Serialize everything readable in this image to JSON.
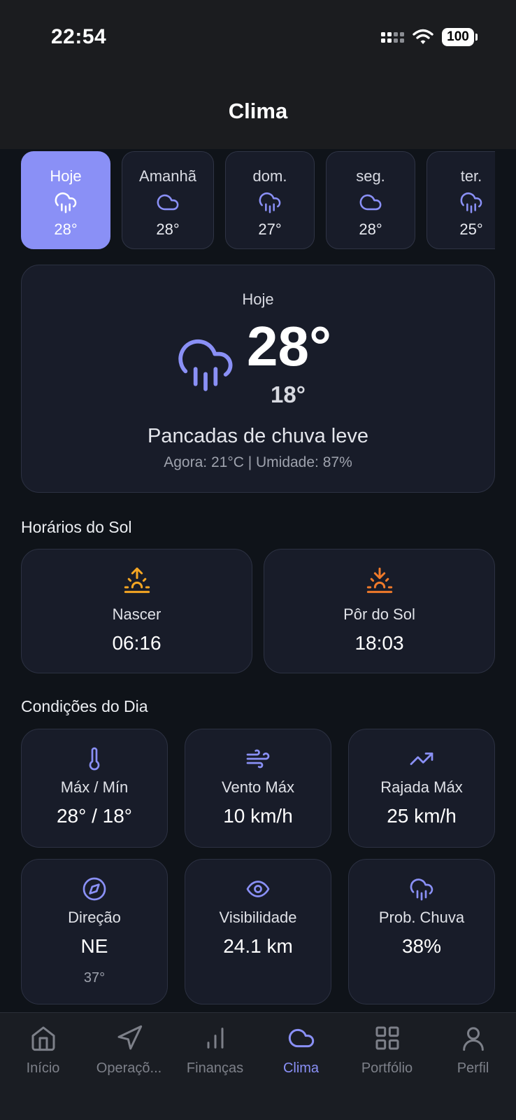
{
  "status_bar": {
    "time": "22:54",
    "battery": "100"
  },
  "header": {
    "title": "Clima"
  },
  "days": [
    {
      "label": "Hoje",
      "temp": "28°",
      "icon": "cloud-rain-icon",
      "active": true
    },
    {
      "label": "Amanhã",
      "temp": "28°",
      "icon": "cloud-icon",
      "active": false
    },
    {
      "label": "dom.",
      "temp": "27°",
      "icon": "cloud-rain-icon",
      "active": false
    },
    {
      "label": "seg.",
      "temp": "28°",
      "icon": "cloud-icon",
      "active": false
    },
    {
      "label": "ter.",
      "temp": "25°",
      "icon": "cloud-rain-icon",
      "active": false
    }
  ],
  "today": {
    "label": "Hoje",
    "max": "28°",
    "min": "18°",
    "description": "Pancadas de chuva leve",
    "now": "Agora: 21°C | Umidade: 87%"
  },
  "sun": {
    "title": "Horários do Sol",
    "sunrise": {
      "label": "Nascer",
      "time": "06:16"
    },
    "sunset": {
      "label": "Pôr do Sol",
      "time": "18:03"
    }
  },
  "conditions": {
    "title": "Condições do Dia",
    "items": [
      {
        "label": "Máx / Mín",
        "value": "28° / 18°",
        "icon": "thermometer-icon"
      },
      {
        "label": "Vento Máx",
        "value": "10 km/h",
        "icon": "wind-icon"
      },
      {
        "label": "Rajada Máx",
        "value": "25 km/h",
        "icon": "trending-up-icon"
      },
      {
        "label": "Direção",
        "value": "NE",
        "sub": "37°",
        "icon": "compass-icon"
      },
      {
        "label": "Visibilidade",
        "value": "24.1 km",
        "icon": "eye-icon"
      },
      {
        "label": "Prob. Chuva",
        "value": "38%",
        "icon": "cloud-rain-icon"
      }
    ]
  },
  "tabbar": {
    "items": [
      {
        "label": "Início",
        "icon": "home-icon"
      },
      {
        "label": "Operaçõ...",
        "icon": "navigation-icon"
      },
      {
        "label": "Finanças",
        "icon": "bar-chart-icon"
      },
      {
        "label": "Clima",
        "icon": "cloud-icon"
      },
      {
        "label": "Portfólio",
        "icon": "grid-icon"
      },
      {
        "label": "Perfil",
        "icon": "user-icon"
      }
    ],
    "active_index": 3
  },
  "colors": {
    "accent": "#8a90f6",
    "sunrise": "#f5a623",
    "sunset": "#f07a2a",
    "card": "#181c29",
    "background": "#0f1319"
  }
}
